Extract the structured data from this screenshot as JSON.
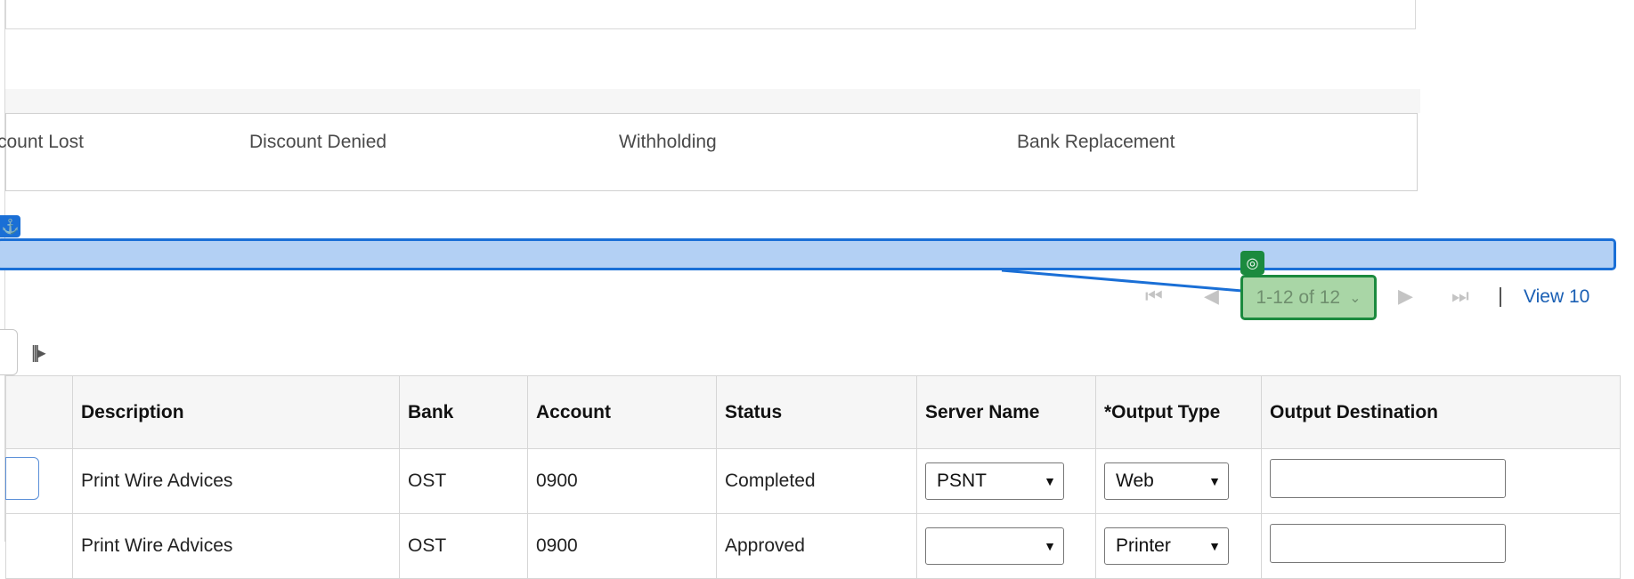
{
  "tabs": [
    "count Lost",
    "Discount Denied",
    "Withholding",
    "Bank Replacement"
  ],
  "pager": {
    "range_label": "1-12 of 12",
    "view_label": "View 10"
  },
  "table": {
    "headers": [
      "Description",
      "Bank",
      "Account",
      "Status",
      "Server Name",
      "*Output Type",
      "Output Destination"
    ],
    "rows": [
      {
        "description": "Print Wire Advices",
        "bank": "OST",
        "account": "0900",
        "status": "Completed",
        "server": "PSNT",
        "output_type": "Web",
        "destination": ""
      },
      {
        "description": "Print Wire Advices",
        "bank": "OST",
        "account": "0900",
        "status": "Approved",
        "server": "",
        "output_type": "Printer",
        "destination": ""
      }
    ]
  },
  "overlay": {
    "highlight_color": "#b3d0f4",
    "anchor_color": "#1a6fd6",
    "target_color": "#1b8a3e"
  },
  "icons": {
    "anchor": "anchor-icon",
    "target": "target-icon",
    "first_page": "first-page-icon",
    "prev_page": "prev-page-icon",
    "next_page": "next-page-icon",
    "last_page": "last-page-icon",
    "columns": "column-chooser-icon"
  }
}
